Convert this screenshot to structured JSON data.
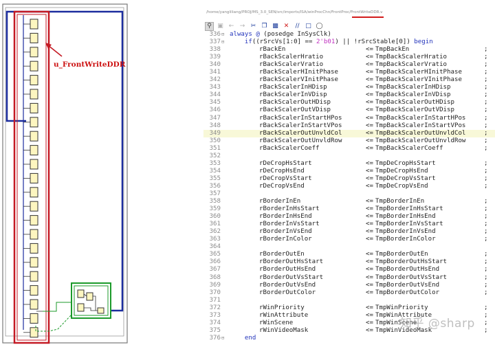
{
  "schematic": {
    "instance_label": "u_FrontWriteDDR",
    "colors": {
      "outer_frame": "#777777",
      "blue_wire": "#1b2c9e",
      "red_box": "#c41a24",
      "green_wire": "#1b9a2a",
      "block_fill": "#fdf6c0",
      "block_border": "#333333"
    }
  },
  "editor": {
    "file_path": "/home/yangliliang/PROJ/MS_3.0_SEN/src/imports/ISA/winProcChn/FrontProc/FrontWriteDDR.v",
    "toolbar": [
      "search-icon",
      "save-icon",
      "back-icon",
      "forward-icon",
      "cut-icon",
      "copy-icon",
      "paste-icon",
      "delete-icon",
      "comment-icon",
      "bookmark-icon",
      "bulb-icon"
    ],
    "lines": [
      {
        "n": "336",
        "fold": "⊟",
        "kind": "ctl",
        "pre": "",
        "kw": "always @ ",
        "text": "(posedge InSysClk)"
      },
      {
        "n": "337",
        "fold": "⊟",
        "kind": "ctl2",
        "pre": "    ",
        "kw": "if",
        "text": "((rSrcVs[1:0] == ",
        "lit": "2'b01",
        "post": ") || !rSrcStable[0]) ",
        "kw2": "begin"
      },
      {
        "n": "338",
        "lhs": "rBackEn",
        "rhs": "TmpBackEn"
      },
      {
        "n": "339",
        "lhs": "rBackScalerHratio",
        "rhs": "TmpBackScalerHratio"
      },
      {
        "n": "340",
        "lhs": "rBackScalerVratio",
        "rhs": "TmpBackScalerVratio"
      },
      {
        "n": "341",
        "lhs": "rBackScalerHInitPhase",
        "rhs": "TmpBackScalerHInitPhase"
      },
      {
        "n": "342",
        "lhs": "rBackScalerVInitPhase",
        "rhs": "TmpBackScalerVInitPhase"
      },
      {
        "n": "343",
        "lhs": "rBackScalerInHDisp",
        "rhs": "TmpBackScalerInHDisp"
      },
      {
        "n": "344",
        "lhs": "rBackScalerInVDisp",
        "rhs": "TmpBackScalerInVDisp"
      },
      {
        "n": "345",
        "lhs": "rBackScalerOutHDisp",
        "rhs": "TmpBackScalerOutHDisp"
      },
      {
        "n": "346",
        "lhs": "rBackScalerOutVDisp",
        "rhs": "TmpBackScalerOutVDisp"
      },
      {
        "n": "347",
        "lhs": "rBackScalerInStartHPos",
        "rhs": "TmpBackScalerInStartHPos"
      },
      {
        "n": "348",
        "lhs": "rBackScalerInStartVPos",
        "rhs": "TmpBackScalerInStartVPos"
      },
      {
        "n": "349",
        "lhs": "rBackScalerOutUnvldCol",
        "rhs": "TmpBackScalerOutUnvldCol",
        "hl": true
      },
      {
        "n": "350",
        "lhs": "rBackScalerOutUnvldRow",
        "rhs": "TmpBackScalerOutUnvldRow"
      },
      {
        "n": "351",
        "lhs": "rBackScalerCoeff",
        "rhs": "TmpBackScalerCoeff"
      },
      {
        "n": "352"
      },
      {
        "n": "353",
        "lhs": "rDeCropHsStart",
        "rhs": "TmpDeCropHsStart"
      },
      {
        "n": "354",
        "lhs": "rDeCropHsEnd",
        "rhs": "TmpDeCropHsEnd"
      },
      {
        "n": "355",
        "lhs": "rDeCropVsStart",
        "rhs": "TmpDeCropVsStart"
      },
      {
        "n": "356",
        "lhs": "rDeCropVsEnd",
        "rhs": "TmpDeCropVsEnd"
      },
      {
        "n": "357"
      },
      {
        "n": "358",
        "lhs": "rBorderInEn",
        "rhs": "TmpBorderInEn"
      },
      {
        "n": "359",
        "lhs": "rBorderInHsStart",
        "rhs": "TmpBorderInHsStart"
      },
      {
        "n": "360",
        "lhs": "rBorderInHsEnd",
        "rhs": "TmpBorderInHsEnd"
      },
      {
        "n": "361",
        "lhs": "rBorderInVsStart",
        "rhs": "TmpBorderInVsStart"
      },
      {
        "n": "362",
        "lhs": "rBorderInVsEnd",
        "rhs": "TmpBorderInVsEnd"
      },
      {
        "n": "363",
        "lhs": "rBorderInColor",
        "rhs": "TmpBorderInColor"
      },
      {
        "n": "364"
      },
      {
        "n": "365",
        "lhs": "rBorderOutEn",
        "rhs": "TmpBorderOutEn"
      },
      {
        "n": "366",
        "lhs": "rBorderOutHsStart",
        "rhs": "TmpBorderOutHsStart"
      },
      {
        "n": "367",
        "lhs": "rBorderOutHsEnd",
        "rhs": "TmpBorderOutHsEnd"
      },
      {
        "n": "368",
        "lhs": "rBorderOutVsStart",
        "rhs": "TmpBorderOutVsStart"
      },
      {
        "n": "369",
        "lhs": "rBorderOutVsEnd",
        "rhs": "TmpBorderOutVsEnd"
      },
      {
        "n": "370",
        "lhs": "rBorderOutColor",
        "rhs": "TmpBorderOutColor"
      },
      {
        "n": "371"
      },
      {
        "n": "372",
        "lhs": "rWinPriority",
        "rhs": "TmpWinPriority"
      },
      {
        "n": "373",
        "lhs": "rWinAttribute",
        "rhs": "TmpWinAttribute"
      },
      {
        "n": "374",
        "lhs": "rWinScene",
        "rhs": "TmpWinScene"
      },
      {
        "n": "375",
        "lhs": "rWinVideoMask",
        "rhs": "TmpWinVideoMask"
      },
      {
        "n": "376",
        "fold": "⊟",
        "kind": "end",
        "pre": "    ",
        "kw": "end"
      }
    ],
    "assign_op": "<=",
    "semicolon": ";",
    "colors": {
      "keyword": "#2233bb",
      "literal": "#c030c0",
      "line_number": "#8b8b8b",
      "highlight": "#f8f8d8",
      "path_underline": "#d21a1a"
    }
  },
  "watermark": "知乎 @sharp"
}
